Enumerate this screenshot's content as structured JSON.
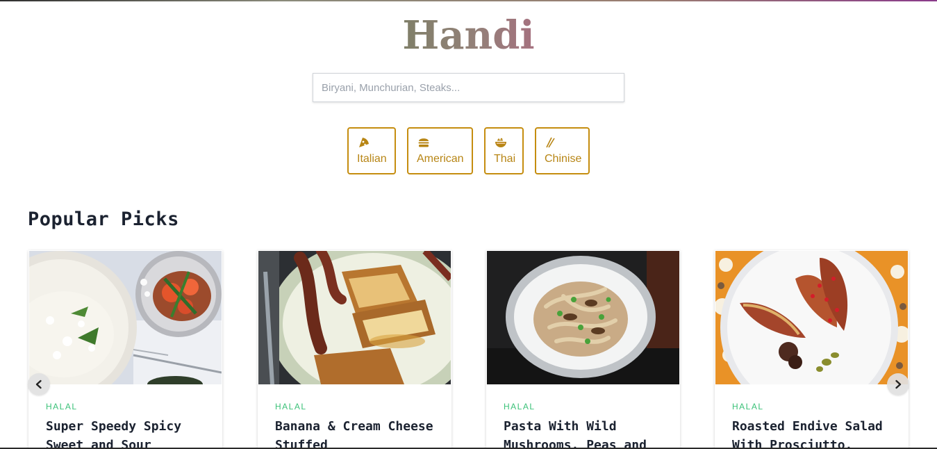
{
  "brand": {
    "title": "Handi"
  },
  "search": {
    "placeholder": "Biryani, Munchurian, Steaks..."
  },
  "categories": [
    {
      "label": "Italian",
      "icon": "pizza-icon"
    },
    {
      "label": "American",
      "icon": "burger-icon"
    },
    {
      "label": "Thai",
      "icon": "noodle-bowl-icon"
    },
    {
      "label": "Chinise",
      "icon": "chopsticks-icon"
    }
  ],
  "section": {
    "title": "Popular Picks"
  },
  "cards": [
    {
      "tag": "HALAL",
      "title": "Super Speedy Spicy Sweet and Sour"
    },
    {
      "tag": "HALAL",
      "title": "Banana & Cream Cheese Stuffed"
    },
    {
      "tag": "HALAL",
      "title": "Pasta With Wild Mushrooms, Peas and"
    },
    {
      "tag": "HALAL",
      "title": "Roasted Endive Salad With Prosciutto,"
    }
  ],
  "carousel": {
    "prev_icon": "chevron-left-icon",
    "next_icon": "chevron-right-icon"
  },
  "colors": {
    "accent": "#c58d0f",
    "tag": "#3bc178",
    "heading": "#1b2230"
  }
}
